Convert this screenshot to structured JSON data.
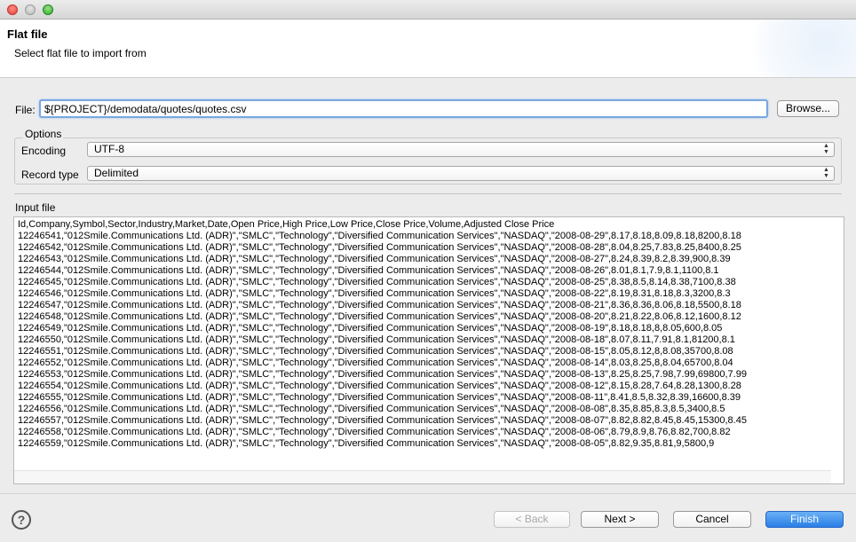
{
  "header": {
    "title": "Flat file",
    "subtitle": "Select flat file to import from"
  },
  "file": {
    "label": "File:",
    "value": "${PROJECT}/demodata/quotes/quotes.csv",
    "browse_label": "Browse..."
  },
  "options": {
    "title": "Options",
    "encoding_label": "Encoding",
    "encoding_value": "UTF-8",
    "record_type_label": "Record type",
    "record_type_value": "Delimited"
  },
  "input_file": {
    "label": "Input file",
    "lines": [
      "Id,Company,Symbol,Sector,Industry,Market,Date,Open Price,High Price,Low Price,Close Price,Volume,Adjusted Close Price",
      "12246541,\"012Smile.Communications Ltd. (ADR)\",\"SMLC\",\"Technology\",\"Diversified Communication Services\",\"NASDAQ\",\"2008-08-29\",8.17,8.18,8.09,8.18,8200,8.18",
      "12246542,\"012Smile.Communications Ltd. (ADR)\",\"SMLC\",\"Technology\",\"Diversified Communication Services\",\"NASDAQ\",\"2008-08-28\",8.04,8.25,7.83,8.25,8400,8.25",
      "12246543,\"012Smile.Communications Ltd. (ADR)\",\"SMLC\",\"Technology\",\"Diversified Communication Services\",\"NASDAQ\",\"2008-08-27\",8.24,8.39,8.2,8.39,900,8.39",
      "12246544,\"012Smile.Communications Ltd. (ADR)\",\"SMLC\",\"Technology\",\"Diversified Communication Services\",\"NASDAQ\",\"2008-08-26\",8.01,8.1,7.9,8.1,1100,8.1",
      "12246545,\"012Smile.Communications Ltd. (ADR)\",\"SMLC\",\"Technology\",\"Diversified Communication Services\",\"NASDAQ\",\"2008-08-25\",8.38,8.5,8.14,8.38,7100,8.38",
      "12246546,\"012Smile.Communications Ltd. (ADR)\",\"SMLC\",\"Technology\",\"Diversified Communication Services\",\"NASDAQ\",\"2008-08-22\",8.19,8.31,8.18,8.3,3200,8.3",
      "12246547,\"012Smile.Communications Ltd. (ADR)\",\"SMLC\",\"Technology\",\"Diversified Communication Services\",\"NASDAQ\",\"2008-08-21\",8.36,8.36,8.06,8.18,5500,8.18",
      "12246548,\"012Smile.Communications Ltd. (ADR)\",\"SMLC\",\"Technology\",\"Diversified Communication Services\",\"NASDAQ\",\"2008-08-20\",8.21,8.22,8.06,8.12,1600,8.12",
      "12246549,\"012Smile.Communications Ltd. (ADR)\",\"SMLC\",\"Technology\",\"Diversified Communication Services\",\"NASDAQ\",\"2008-08-19\",8.18,8.18,8,8.05,600,8.05",
      "12246550,\"012Smile.Communications Ltd. (ADR)\",\"SMLC\",\"Technology\",\"Diversified Communication Services\",\"NASDAQ\",\"2008-08-18\",8.07,8.11,7.91,8.1,81200,8.1",
      "12246551,\"012Smile.Communications Ltd. (ADR)\",\"SMLC\",\"Technology\",\"Diversified Communication Services\",\"NASDAQ\",\"2008-08-15\",8.05,8.12,8,8.08,35700,8.08",
      "12246552,\"012Smile.Communications Ltd. (ADR)\",\"SMLC\",\"Technology\",\"Diversified Communication Services\",\"NASDAQ\",\"2008-08-14\",8.03,8.25,8,8.04,65700,8.04",
      "12246553,\"012Smile.Communications Ltd. (ADR)\",\"SMLC\",\"Technology\",\"Diversified Communication Services\",\"NASDAQ\",\"2008-08-13\",8.25,8.25,7.98,7.99,69800,7.99",
      "12246554,\"012Smile.Communications Ltd. (ADR)\",\"SMLC\",\"Technology\",\"Diversified Communication Services\",\"NASDAQ\",\"2008-08-12\",8.15,8.28,7.64,8.28,1300,8.28",
      "12246555,\"012Smile.Communications Ltd. (ADR)\",\"SMLC\",\"Technology\",\"Diversified Communication Services\",\"NASDAQ\",\"2008-08-11\",8.41,8.5,8.32,8.39,16600,8.39",
      "12246556,\"012Smile.Communications Ltd. (ADR)\",\"SMLC\",\"Technology\",\"Diversified Communication Services\",\"NASDAQ\",\"2008-08-08\",8.35,8.85,8.3,8.5,3400,8.5",
      "12246557,\"012Smile.Communications Ltd. (ADR)\",\"SMLC\",\"Technology\",\"Diversified Communication Services\",\"NASDAQ\",\"2008-08-07\",8.82,8.82,8.45,8.45,15300,8.45",
      "12246558,\"012Smile.Communications Ltd. (ADR)\",\"SMLC\",\"Technology\",\"Diversified Communication Services\",\"NASDAQ\",\"2008-08-06\",8.79,8.9,8.76,8.82,700,8.82",
      "12246559,\"012Smile.Communications Ltd. (ADR)\",\"SMLC\",\"Technology\",\"Diversified Communication Services\",\"NASDAQ\",\"2008-08-05\",8.82,9.35,8.81,9,5800,9"
    ]
  },
  "footer": {
    "help_glyph": "?",
    "back_label": "< Back",
    "next_label": "Next >",
    "cancel_label": "Cancel",
    "finish_label": "Finish"
  },
  "icons": {
    "help": "help-icon",
    "select_arrows": "updown-arrows-icon"
  },
  "colors": {
    "focus_border": "#7aa7e0",
    "primary_button": "#2a7fe6"
  }
}
